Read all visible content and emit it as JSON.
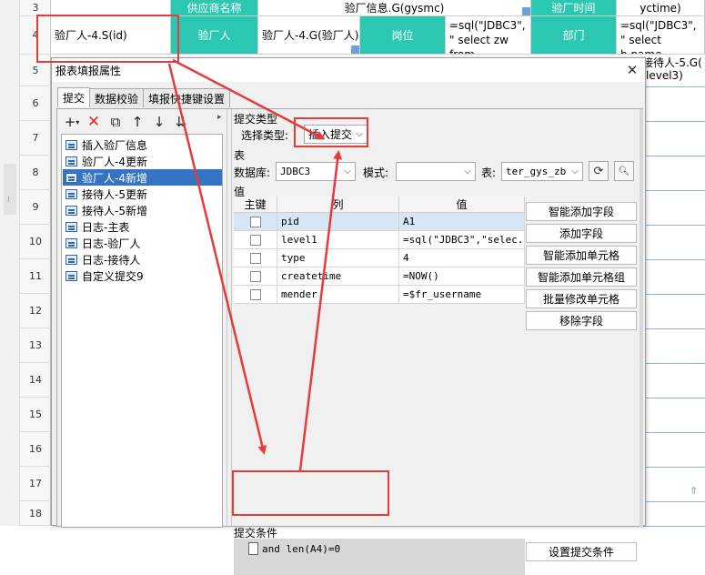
{
  "sheet": {
    "row_numbers": [
      "3",
      "4",
      "5",
      "6",
      "7",
      "8",
      "9",
      "10",
      "11",
      "12",
      "13",
      "14",
      "15",
      "16",
      "17",
      "18"
    ],
    "row3": {
      "supplier_header": "供应商名称",
      "supplier_expr": "验厂信息.G(gysmc)",
      "inspect_time_header": "验厂时间",
      "ycdate_expr": "yctime)"
    },
    "row4": {
      "a": "验厂人-4.S(id)",
      "b": "验厂人",
      "c": "验厂人-4.G(验厂人)",
      "d": "岗位",
      "e": "=sql(\"JDBC3\", \" select zw from",
      "f": "部门",
      "g": "=sql(\"JDBC3\", \" select b.name"
    },
    "row5": {
      "partial": "接待人-5.G(",
      "partial2": "level3)"
    }
  },
  "dialog": {
    "title": "报表填报属性",
    "close": "✕",
    "tabs": [
      "提交",
      "数据校验",
      "填报快捷键设置"
    ],
    "toolbar": {
      "add": "+",
      "add_arrow": "▾",
      "delete": "✕",
      "copy": "⧉",
      "up": "↑",
      "down": "↓",
      "import": "⇊",
      "more": "▸"
    },
    "submit_list": [
      "插入验厂信息",
      "验厂人-4更新",
      "验厂人-4新增",
      "接待人-5更新",
      "接待人-5新增",
      "日志-主表",
      "日志-验厂人",
      "日志-接待人",
      "自定义提交9"
    ],
    "selected_index": 2,
    "submit_type": {
      "section": "提交类型",
      "label": "选择类型:",
      "value": "插入提交"
    },
    "table_section": {
      "section": "表",
      "db_label": "数据库:",
      "db_value": "JDBC3",
      "schema_label": "模式:",
      "schema_value": "",
      "table_label": "表:",
      "table_value": "ter_gys_zb"
    },
    "values_section": {
      "section": "值",
      "headers": [
        "主键",
        "列",
        "值"
      ],
      "rows": [
        {
          "column": "pid",
          "value": "A1"
        },
        {
          "column": "level1",
          "value": "=sql(\"JDBC3\",\"selec..."
        },
        {
          "column": "type",
          "value": "4"
        },
        {
          "column": "createtime",
          "value": "=NOW()"
        },
        {
          "column": "mender",
          "value": "=$fr_username"
        }
      ]
    },
    "field_buttons": [
      "智能添加字段",
      "添加字段",
      "智能添加单元格",
      "智能添加单元格组",
      "批量修改单元格",
      "移除字段"
    ],
    "condition": {
      "section": "提交条件",
      "value": "and len(A4)=0",
      "button": "设置提交条件"
    },
    "icons": {
      "refresh": "⟳",
      "preview": "🔍︎"
    }
  },
  "colors": {
    "teal": "#2cc7b1",
    "highlight_red": "#e8393b",
    "selection_blue": "#3574c2"
  }
}
